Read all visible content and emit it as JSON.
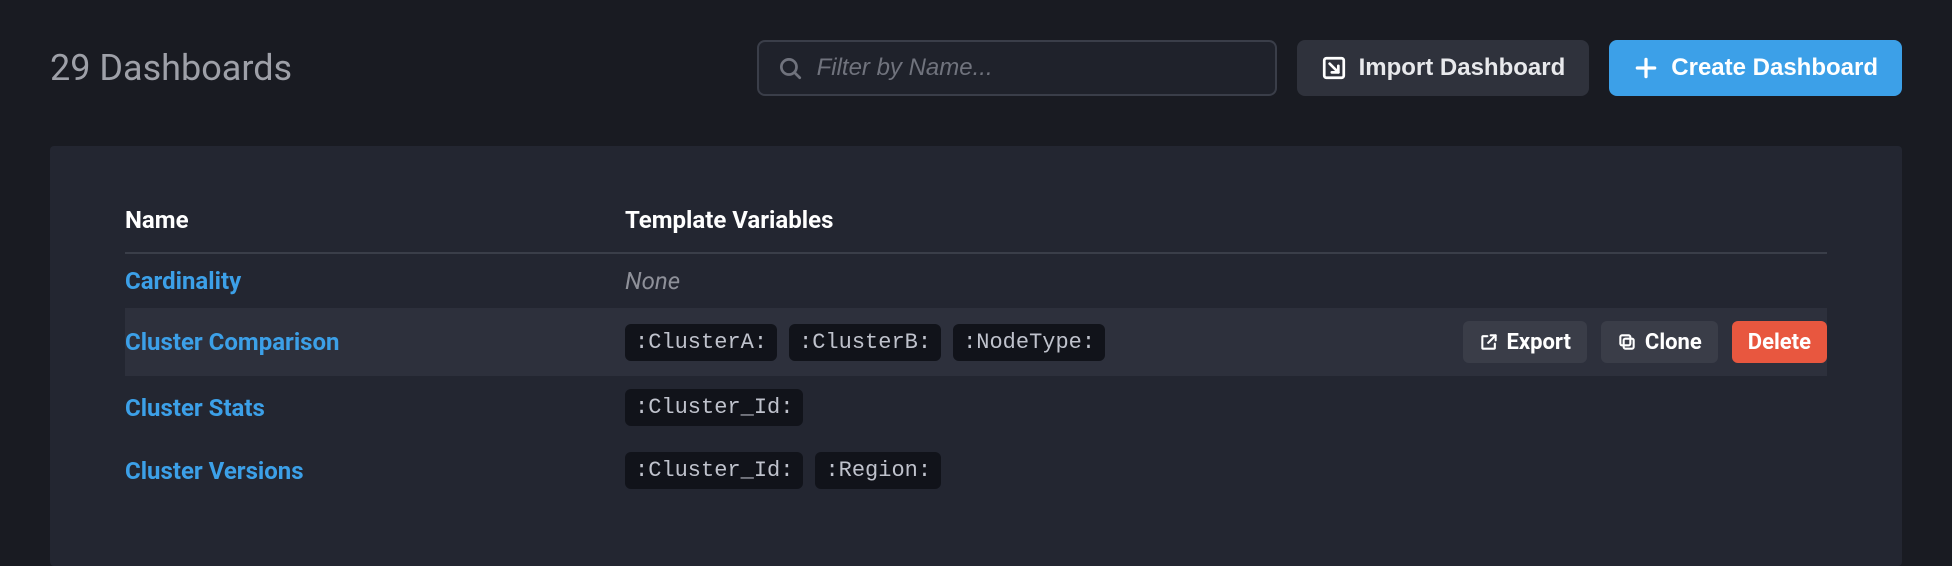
{
  "header": {
    "title": "29 Dashboards",
    "search_placeholder": "Filter by Name...",
    "import_label": "Import Dashboard",
    "create_label": "Create Dashboard"
  },
  "table": {
    "columns": {
      "name": "Name",
      "vars": "Template Variables"
    },
    "none_label": "None",
    "rows": [
      {
        "name": "Cardinality",
        "vars": [],
        "active": false
      },
      {
        "name": "Cluster Comparison",
        "vars": [
          ":ClusterA:",
          ":ClusterB:",
          ":NodeType:"
        ],
        "active": true
      },
      {
        "name": "Cluster Stats",
        "vars": [
          ":Cluster_Id:"
        ],
        "active": false
      },
      {
        "name": "Cluster Versions",
        "vars": [
          ":Cluster_Id:",
          ":Region:"
        ],
        "active": false
      }
    ],
    "actions": {
      "export": "Export",
      "clone": "Clone",
      "delete": "Delete"
    }
  }
}
